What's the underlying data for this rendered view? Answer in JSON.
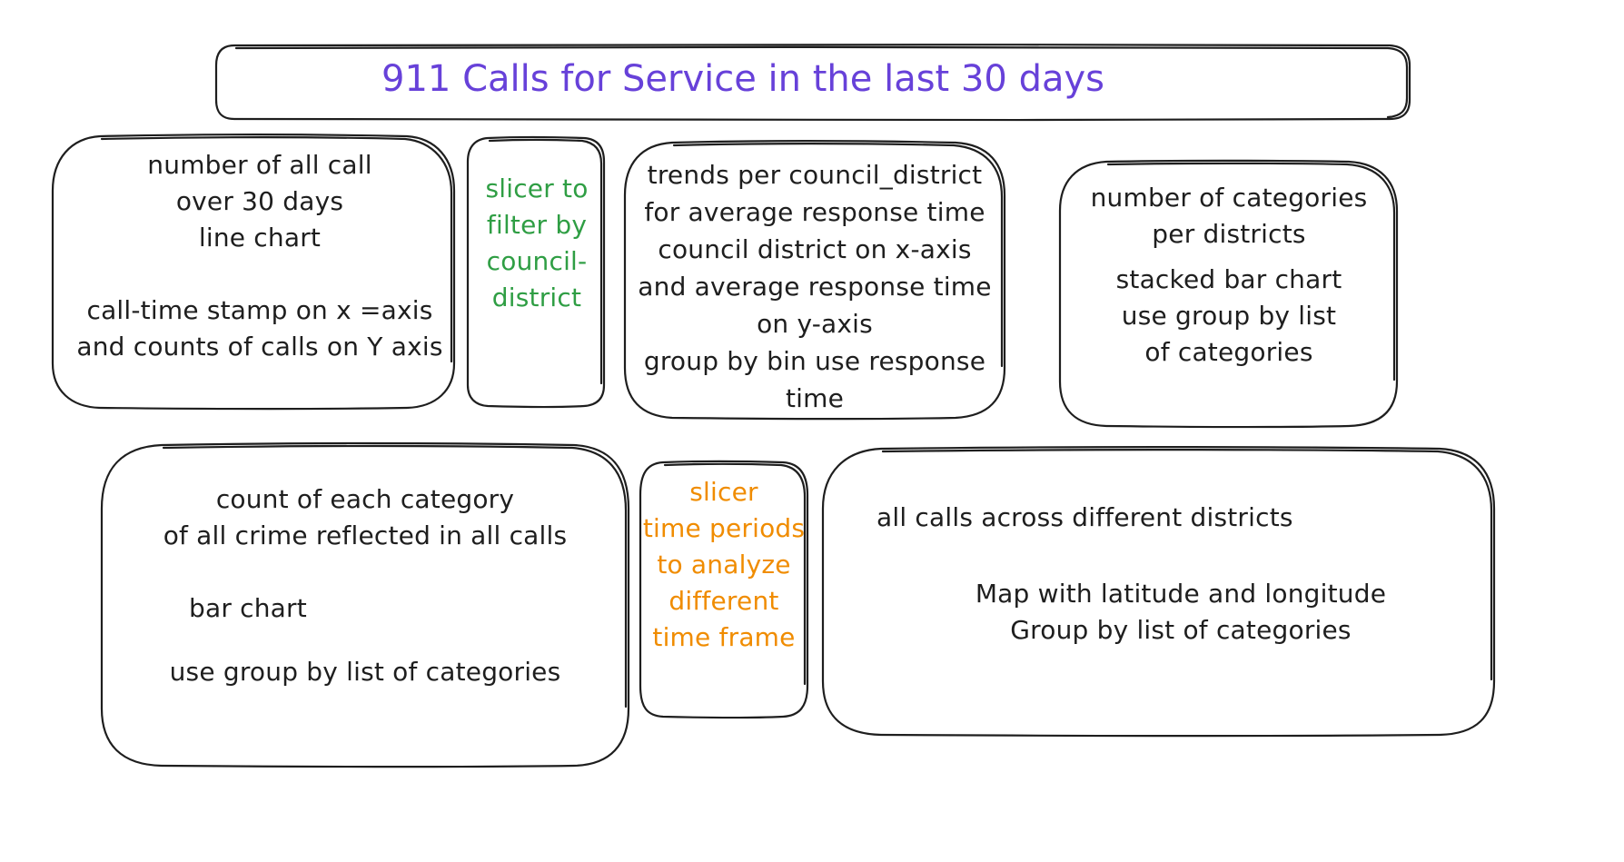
{
  "title": "911 Calls for Service in the last 30 days",
  "colors": {
    "stroke": "#1e1e1e",
    "title": "#6741d9",
    "district_slicer": "#2f9e44",
    "time_slicer": "#f08c00"
  },
  "boxes": {
    "calls_line_chart": {
      "lines": [
        "number of all call",
        "over 30 days",
        "line chart",
        "",
        "call-time stamp on x =axis",
        "and counts of calls on Y axis"
      ]
    },
    "district_slicer": {
      "lines": [
        "slicer to",
        "filter by",
        "council-",
        "district"
      ]
    },
    "response_time_trends": {
      "lines": [
        "trends per council_district",
        "for average response time",
        "council district on x-axis",
        "and average response time",
        "on y-axis",
        "group by bin use response",
        "time"
      ]
    },
    "categories_stacked_bar": {
      "lines": [
        "number of categories",
        "per districts",
        "stacked bar chart",
        "use group by list",
        "of categories"
      ]
    },
    "category_bar_chart": {
      "lines": [
        "count of each category",
        "of all crime reflected in all calls",
        "",
        "bar chart",
        "",
        "use group by list of categories"
      ]
    },
    "time_slicer": {
      "lines": [
        "slicer",
        "time periods",
        "to analyze",
        "different",
        "time frame"
      ]
    },
    "district_map": {
      "lines": [
        "all calls across different districts",
        "",
        "Map  with latitude and longitude",
        "Group by list of categories"
      ]
    }
  }
}
